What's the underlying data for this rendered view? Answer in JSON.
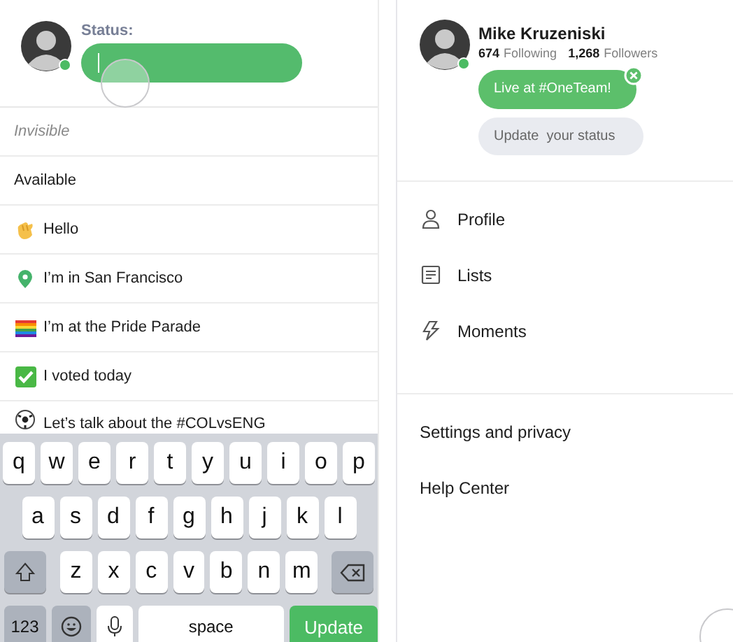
{
  "status_editor": {
    "label": "Status:",
    "online": true,
    "focused": true
  },
  "status_options": [
    {
      "kind": "plain",
      "text": "Invisible",
      "muted": true
    },
    {
      "kind": "plain",
      "text": "Available",
      "muted": false
    },
    {
      "kind": "wave",
      "text": "Hello",
      "muted": false
    },
    {
      "kind": "pin",
      "text": "I’m in San Francisco",
      "muted": false
    },
    {
      "kind": "rainbow",
      "text": "I’m at the Pride Parade",
      "muted": false
    },
    {
      "kind": "check",
      "text": "I voted today",
      "muted": false
    },
    {
      "kind": "ball",
      "text": "Let’s talk about the #COLvsENG",
      "muted": false
    }
  ],
  "keyboard": {
    "top_row": [
      {
        "kind": "letter",
        "label": "q"
      },
      {
        "kind": "letter",
        "label": "w"
      },
      {
        "kind": "letter",
        "label": "e"
      },
      {
        "kind": "letter",
        "label": "r"
      },
      {
        "kind": "letter",
        "label": "t"
      },
      {
        "kind": "letter",
        "label": "y"
      },
      {
        "kind": "letter",
        "label": "u"
      },
      {
        "kind": "letter",
        "label": "i"
      },
      {
        "kind": "letter",
        "label": "o"
      },
      {
        "kind": "letter",
        "label": "p"
      }
    ],
    "middle_row": [
      {
        "kind": "letter",
        "label": "a"
      },
      {
        "kind": "letter",
        "label": "s"
      },
      {
        "kind": "letter",
        "label": "d"
      },
      {
        "kind": "letter",
        "label": "f"
      },
      {
        "kind": "letter",
        "label": "g"
      },
      {
        "kind": "letter",
        "label": "h"
      },
      {
        "kind": "letter",
        "label": "j"
      },
      {
        "kind": "letter",
        "label": "k"
      },
      {
        "kind": "letter",
        "label": "l"
      }
    ],
    "lower_row": [
      {
        "kind": "shift"
      },
      {
        "kind": "letter",
        "label": "z"
      },
      {
        "kind": "letter",
        "label": "x"
      },
      {
        "kind": "letter",
        "label": "c"
      },
      {
        "kind": "letter",
        "label": "v"
      },
      {
        "kind": "letter",
        "label": "b"
      },
      {
        "kind": "letter",
        "label": "n"
      },
      {
        "kind": "letter",
        "label": "m"
      },
      {
        "kind": "backspace"
      }
    ],
    "bottom_row": [
      {
        "kind": "numbers",
        "label": "123"
      },
      {
        "kind": "emoji"
      },
      {
        "kind": "mic"
      },
      {
        "kind": "space",
        "label": "space"
      },
      {
        "kind": "action",
        "label": "Update"
      }
    ]
  },
  "profile": {
    "name": "Mike Kruzeniski",
    "online": true,
    "following_count": "674",
    "following_label": "Following",
    "followers_count": "1,268",
    "followers_label": "Followers",
    "live_status": "Live at #OneTeam!",
    "update_prompt": "Update  your status"
  },
  "menu": [
    {
      "kind": "person",
      "label": "Profile"
    },
    {
      "kind": "list",
      "label": "Lists"
    },
    {
      "kind": "bolt",
      "label": "Moments"
    }
  ],
  "secondary_menu": [
    {
      "label": "Settings and privacy"
    },
    {
      "label": "Help Center"
    }
  ]
}
